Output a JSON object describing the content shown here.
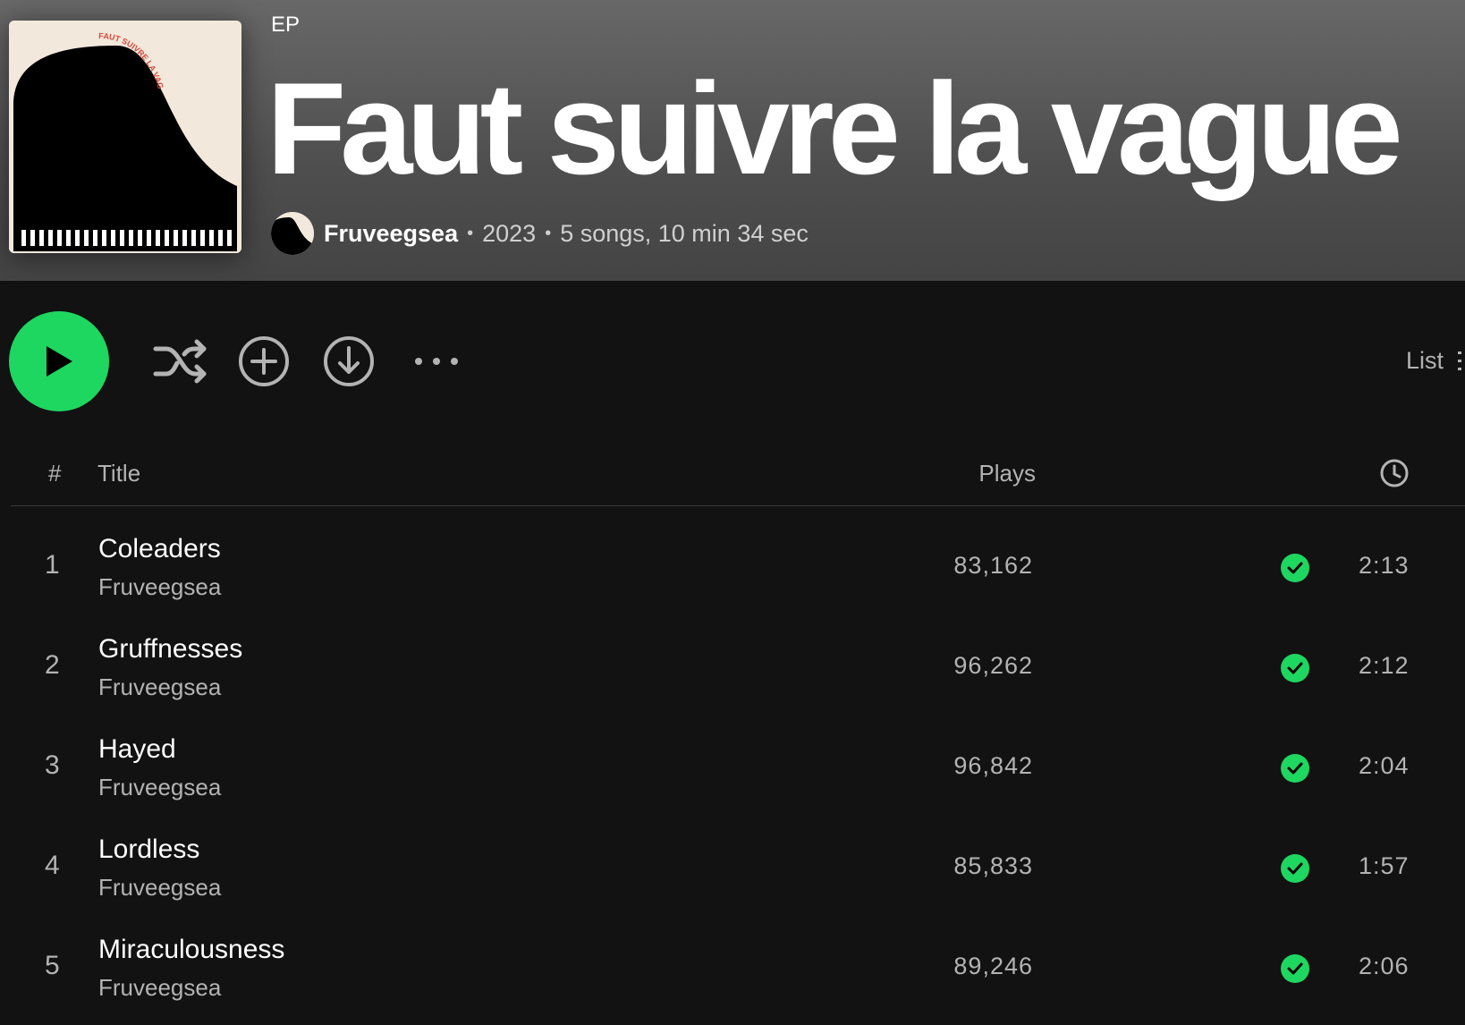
{
  "album": {
    "type": "EP",
    "title": "Faut suivre la vague",
    "cover_text": "FAUT SUIVRE LA VAGUE",
    "artist": "Fruveegsea",
    "year": "2023",
    "summary": "5 songs, 10 min 34 sec"
  },
  "controls": {
    "view_label": "List",
    "icons": [
      "play-icon",
      "shuffle-icon",
      "add-icon",
      "download-icon",
      "more-icon",
      "list-icon"
    ]
  },
  "table": {
    "headers": {
      "number": "#",
      "title": "Title",
      "plays": "Plays",
      "duration_icon": "clock-icon"
    },
    "tracks": [
      {
        "number": "1",
        "title": "Coleaders",
        "artist": "Fruveegsea",
        "plays": "83,162",
        "duration": "2:13",
        "downloaded": true
      },
      {
        "number": "2",
        "title": "Gruffnesses",
        "artist": "Fruveegsea",
        "plays": "96,262",
        "duration": "2:12",
        "downloaded": true
      },
      {
        "number": "3",
        "title": "Hayed",
        "artist": "Fruveegsea",
        "plays": "96,842",
        "duration": "2:04",
        "downloaded": true
      },
      {
        "number": "4",
        "title": "Lordless",
        "artist": "Fruveegsea",
        "plays": "85,833",
        "duration": "1:57",
        "downloaded": true
      },
      {
        "number": "5",
        "title": "Miraculousness",
        "artist": "Fruveegsea",
        "plays": "89,246",
        "duration": "2:06",
        "downloaded": true
      }
    ]
  },
  "colors": {
    "accent": "#1ed760",
    "background": "#121212",
    "header_gradient_top": "#686868",
    "muted_text": "#b3b3b3"
  }
}
